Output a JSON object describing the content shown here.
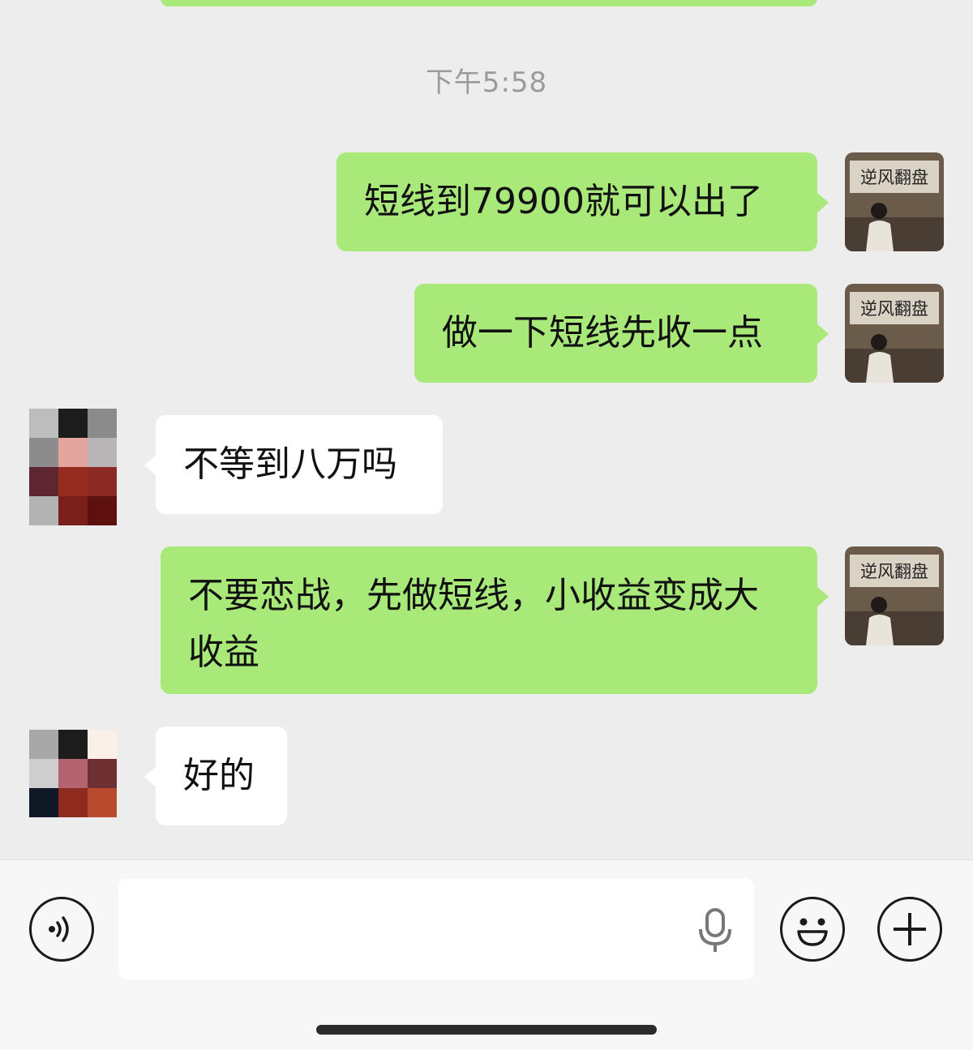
{
  "chat": {
    "timestamp": "下午5:58",
    "messages": [
      {
        "sender": "me",
        "text": "短线到79900就可以出了"
      },
      {
        "sender": "me",
        "text": "做一下短线先收一点"
      },
      {
        "sender": "other",
        "text": "不等到八万吗"
      },
      {
        "sender": "me",
        "text": "不要恋战，先做短线，小收益变成大收益"
      },
      {
        "sender": "other",
        "text": "好的"
      }
    ],
    "my_avatar_caption": "逆风翻盘"
  },
  "input_bar": {
    "placeholder": "",
    "icons": [
      "voice-icon",
      "microphone-icon",
      "emoji-icon",
      "plus-icon"
    ]
  },
  "colors": {
    "background": "#ededed",
    "outgoing_bubble": "#a9e97a",
    "incoming_bubble": "#ffffff",
    "timestamp": "#9a9a9a"
  }
}
